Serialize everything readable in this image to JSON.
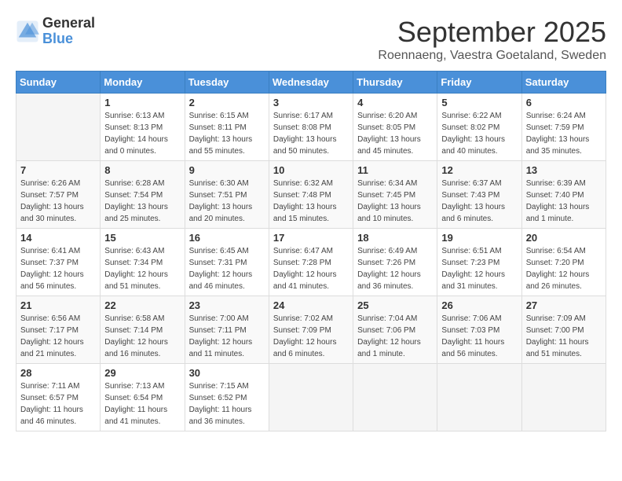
{
  "header": {
    "logo_general": "General",
    "logo_blue": "Blue",
    "month_title": "September 2025",
    "location": "Roennaeng, Vaestra Goetaland, Sweden"
  },
  "days_of_week": [
    "Sunday",
    "Monday",
    "Tuesday",
    "Wednesday",
    "Thursday",
    "Friday",
    "Saturday"
  ],
  "weeks": [
    [
      {
        "day": "",
        "sunrise": "",
        "sunset": "",
        "daylight": ""
      },
      {
        "day": "1",
        "sunrise": "Sunrise: 6:13 AM",
        "sunset": "Sunset: 8:13 PM",
        "daylight": "Daylight: 14 hours and 0 minutes."
      },
      {
        "day": "2",
        "sunrise": "Sunrise: 6:15 AM",
        "sunset": "Sunset: 8:11 PM",
        "daylight": "Daylight: 13 hours and 55 minutes."
      },
      {
        "day": "3",
        "sunrise": "Sunrise: 6:17 AM",
        "sunset": "Sunset: 8:08 PM",
        "daylight": "Daylight: 13 hours and 50 minutes."
      },
      {
        "day": "4",
        "sunrise": "Sunrise: 6:20 AM",
        "sunset": "Sunset: 8:05 PM",
        "daylight": "Daylight: 13 hours and 45 minutes."
      },
      {
        "day": "5",
        "sunrise": "Sunrise: 6:22 AM",
        "sunset": "Sunset: 8:02 PM",
        "daylight": "Daylight: 13 hours and 40 minutes."
      },
      {
        "day": "6",
        "sunrise": "Sunrise: 6:24 AM",
        "sunset": "Sunset: 7:59 PM",
        "daylight": "Daylight: 13 hours and 35 minutes."
      }
    ],
    [
      {
        "day": "7",
        "sunrise": "Sunrise: 6:26 AM",
        "sunset": "Sunset: 7:57 PM",
        "daylight": "Daylight: 13 hours and 30 minutes."
      },
      {
        "day": "8",
        "sunrise": "Sunrise: 6:28 AM",
        "sunset": "Sunset: 7:54 PM",
        "daylight": "Daylight: 13 hours and 25 minutes."
      },
      {
        "day": "9",
        "sunrise": "Sunrise: 6:30 AM",
        "sunset": "Sunset: 7:51 PM",
        "daylight": "Daylight: 13 hours and 20 minutes."
      },
      {
        "day": "10",
        "sunrise": "Sunrise: 6:32 AM",
        "sunset": "Sunset: 7:48 PM",
        "daylight": "Daylight: 13 hours and 15 minutes."
      },
      {
        "day": "11",
        "sunrise": "Sunrise: 6:34 AM",
        "sunset": "Sunset: 7:45 PM",
        "daylight": "Daylight: 13 hours and 10 minutes."
      },
      {
        "day": "12",
        "sunrise": "Sunrise: 6:37 AM",
        "sunset": "Sunset: 7:43 PM",
        "daylight": "Daylight: 13 hours and 6 minutes."
      },
      {
        "day": "13",
        "sunrise": "Sunrise: 6:39 AM",
        "sunset": "Sunset: 7:40 PM",
        "daylight": "Daylight: 13 hours and 1 minute."
      }
    ],
    [
      {
        "day": "14",
        "sunrise": "Sunrise: 6:41 AM",
        "sunset": "Sunset: 7:37 PM",
        "daylight": "Daylight: 12 hours and 56 minutes."
      },
      {
        "day": "15",
        "sunrise": "Sunrise: 6:43 AM",
        "sunset": "Sunset: 7:34 PM",
        "daylight": "Daylight: 12 hours and 51 minutes."
      },
      {
        "day": "16",
        "sunrise": "Sunrise: 6:45 AM",
        "sunset": "Sunset: 7:31 PM",
        "daylight": "Daylight: 12 hours and 46 minutes."
      },
      {
        "day": "17",
        "sunrise": "Sunrise: 6:47 AM",
        "sunset": "Sunset: 7:28 PM",
        "daylight": "Daylight: 12 hours and 41 minutes."
      },
      {
        "day": "18",
        "sunrise": "Sunrise: 6:49 AM",
        "sunset": "Sunset: 7:26 PM",
        "daylight": "Daylight: 12 hours and 36 minutes."
      },
      {
        "day": "19",
        "sunrise": "Sunrise: 6:51 AM",
        "sunset": "Sunset: 7:23 PM",
        "daylight": "Daylight: 12 hours and 31 minutes."
      },
      {
        "day": "20",
        "sunrise": "Sunrise: 6:54 AM",
        "sunset": "Sunset: 7:20 PM",
        "daylight": "Daylight: 12 hours and 26 minutes."
      }
    ],
    [
      {
        "day": "21",
        "sunrise": "Sunrise: 6:56 AM",
        "sunset": "Sunset: 7:17 PM",
        "daylight": "Daylight: 12 hours and 21 minutes."
      },
      {
        "day": "22",
        "sunrise": "Sunrise: 6:58 AM",
        "sunset": "Sunset: 7:14 PM",
        "daylight": "Daylight: 12 hours and 16 minutes."
      },
      {
        "day": "23",
        "sunrise": "Sunrise: 7:00 AM",
        "sunset": "Sunset: 7:11 PM",
        "daylight": "Daylight: 12 hours and 11 minutes."
      },
      {
        "day": "24",
        "sunrise": "Sunrise: 7:02 AM",
        "sunset": "Sunset: 7:09 PM",
        "daylight": "Daylight: 12 hours and 6 minutes."
      },
      {
        "day": "25",
        "sunrise": "Sunrise: 7:04 AM",
        "sunset": "Sunset: 7:06 PM",
        "daylight": "Daylight: 12 hours and 1 minute."
      },
      {
        "day": "26",
        "sunrise": "Sunrise: 7:06 AM",
        "sunset": "Sunset: 7:03 PM",
        "daylight": "Daylight: 11 hours and 56 minutes."
      },
      {
        "day": "27",
        "sunrise": "Sunrise: 7:09 AM",
        "sunset": "Sunset: 7:00 PM",
        "daylight": "Daylight: 11 hours and 51 minutes."
      }
    ],
    [
      {
        "day": "28",
        "sunrise": "Sunrise: 7:11 AM",
        "sunset": "Sunset: 6:57 PM",
        "daylight": "Daylight: 11 hours and 46 minutes."
      },
      {
        "day": "29",
        "sunrise": "Sunrise: 7:13 AM",
        "sunset": "Sunset: 6:54 PM",
        "daylight": "Daylight: 11 hours and 41 minutes."
      },
      {
        "day": "30",
        "sunrise": "Sunrise: 7:15 AM",
        "sunset": "Sunset: 6:52 PM",
        "daylight": "Daylight: 11 hours and 36 minutes."
      },
      {
        "day": "",
        "sunrise": "",
        "sunset": "",
        "daylight": ""
      },
      {
        "day": "",
        "sunrise": "",
        "sunset": "",
        "daylight": ""
      },
      {
        "day": "",
        "sunrise": "",
        "sunset": "",
        "daylight": ""
      },
      {
        "day": "",
        "sunrise": "",
        "sunset": "",
        "daylight": ""
      }
    ]
  ]
}
